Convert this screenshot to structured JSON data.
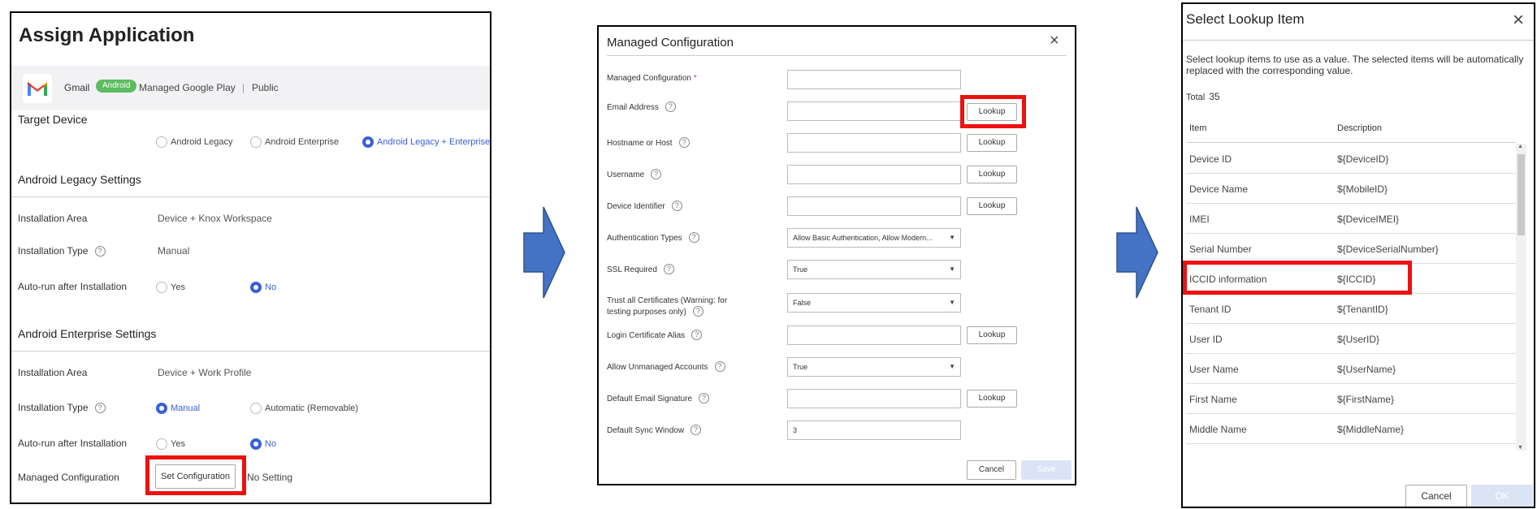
{
  "assign": {
    "title": "Assign Application",
    "app_name": "Gmail",
    "platform_badge": "Android",
    "store": "Managed Google Play",
    "separator": "|",
    "visibility": "Public",
    "target_device": {
      "label": "Target Device",
      "options": [
        "Android Legacy",
        "Android Enterprise",
        "Android Legacy + Enterprise"
      ],
      "selected": "Android Legacy + Enterprise"
    },
    "legacy": {
      "title": "Android Legacy Settings",
      "installation_area_label": "Installation Area",
      "installation_area_value": "Device + Knox Workspace",
      "installation_type_label": "Installation Type",
      "installation_type_value": "Manual",
      "autorun_label": "Auto-run after Installation",
      "autorun_yes": "Yes",
      "autorun_no": "No",
      "autorun_selected": "No"
    },
    "enterprise": {
      "title": "Android Enterprise Settings",
      "installation_area_label": "Installation Area",
      "installation_area_value": "Device + Work Profile",
      "installation_type_label": "Installation Type",
      "installation_type_manual": "Manual",
      "installation_type_auto": "Automatic (Removable)",
      "installation_type_selected": "Manual",
      "autorun_label": "Auto-run after Installation",
      "autorun_yes": "Yes",
      "autorun_no": "No",
      "autorun_selected": "No",
      "managed_config_label": "Managed Configuration",
      "set_config_button": "Set Configuration",
      "managed_config_status": "No Setting"
    }
  },
  "managed_config": {
    "title": "Managed Configuration",
    "required_mark": "*",
    "fields": [
      {
        "label": "Managed Configuration",
        "type": "input",
        "value": "",
        "lookup": false,
        "required": true,
        "help": false
      },
      {
        "label": "Email Address",
        "type": "input",
        "value": "",
        "lookup": true,
        "help": true
      },
      {
        "label": "Hostname or Host",
        "type": "input",
        "value": "",
        "lookup": true,
        "help": true
      },
      {
        "label": "Username",
        "type": "input",
        "value": "",
        "lookup": true,
        "help": true
      },
      {
        "label": "Device Identifier",
        "type": "input",
        "value": "",
        "lookup": true,
        "help": true
      },
      {
        "label": "Authentication Types",
        "type": "select",
        "value": "Allow Basic Authentication, Allow Modern...",
        "help": true
      },
      {
        "label": "SSL Required",
        "type": "select",
        "value": "True",
        "help": true
      },
      {
        "label": "Trust all Certificates (Warning: for",
        "label2": "testing purposes only)",
        "type": "select",
        "value": "False",
        "help": true
      },
      {
        "label": "Login Certificate Alias",
        "type": "input",
        "value": "",
        "lookup": true,
        "help": true
      },
      {
        "label": "Allow Unmanaged Accounts",
        "type": "select",
        "value": "True",
        "help": true
      },
      {
        "label": "Default Email Signature",
        "type": "input",
        "value": "",
        "lookup": true,
        "help": true
      },
      {
        "label": "Default Sync Window",
        "type": "input",
        "value": "3",
        "lookup": false,
        "help": true
      }
    ],
    "lookup_label": "Lookup",
    "cancel_label": "Cancel",
    "save_label": "Save"
  },
  "lookup_dialog": {
    "title": "Select Lookup Item",
    "description": "Select lookup items to use as a value. The selected items will be automatically replaced with the corresponding value.",
    "total_label": "Total",
    "total_value": "35",
    "col_item": "Item",
    "col_description": "Description",
    "rows": [
      {
        "item": "Device ID",
        "desc": "${DeviceID}"
      },
      {
        "item": "Device Name",
        "desc": "${MobileID}"
      },
      {
        "item": "IMEI",
        "desc": "${DeviceIMEI}"
      },
      {
        "item": "Serial Number",
        "desc": "${DeviceSerialNumber}"
      },
      {
        "item": "ICCID information",
        "desc": "${ICCID}"
      },
      {
        "item": "Tenant ID",
        "desc": "${TenantID}"
      },
      {
        "item": "User ID",
        "desc": "${UserID}"
      },
      {
        "item": "User Name",
        "desc": "${UserName}"
      },
      {
        "item": "First Name",
        "desc": "${FirstName}"
      },
      {
        "item": "Middle Name",
        "desc": "${MiddleName}"
      }
    ],
    "cancel_label": "Cancel",
    "ok_label": "OK"
  },
  "colors": {
    "accent": "#3a5fd9",
    "highlight": "#ee1111",
    "badge": "#5dbb60",
    "arrow": "#4472c4",
    "disabled_button": "#dbe4f5"
  },
  "icons": {
    "app_logo": "gmail-icon",
    "close": "close-icon",
    "help": "help-icon",
    "dropdown": "chevron-down-icon",
    "flow": "right-arrow-icon"
  }
}
